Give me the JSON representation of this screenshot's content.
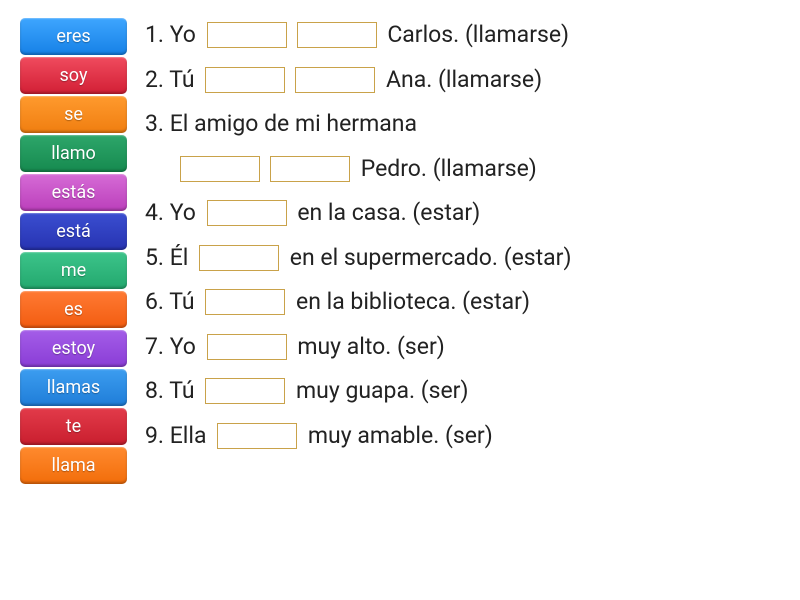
{
  "words": [
    {
      "label": "eres",
      "color1": "#3ea6ff",
      "color2": "#1681e6"
    },
    {
      "label": "soy",
      "color1": "#f04b5e",
      "color2": "#d21f35"
    },
    {
      "label": "se",
      "color1": "#ff9a2e",
      "color2": "#f07e10"
    },
    {
      "label": "llamo",
      "color1": "#2da66a",
      "color2": "#168a4f"
    },
    {
      "label": "estás",
      "color1": "#d66bd6",
      "color2": "#bb3fbb"
    },
    {
      "label": "está",
      "color1": "#3a4ed0",
      "color2": "#2733b2"
    },
    {
      "label": "me",
      "color1": "#3cc48a",
      "color2": "#23a86e"
    },
    {
      "label": "es",
      "color1": "#ff7a33",
      "color2": "#f25c10"
    },
    {
      "label": "estoy",
      "color1": "#a45de8",
      "color2": "#8a3dd6"
    },
    {
      "label": "llamas",
      "color1": "#3c9df0",
      "color2": "#1f7dd8"
    },
    {
      "label": "te",
      "color1": "#e23b4a",
      "color2": "#c91e2e"
    },
    {
      "label": "llama",
      "color1": "#ff8a2e",
      "color2": "#f26d0a"
    }
  ],
  "lines": {
    "l1a": "1. Yo ",
    "l1b": " Carlos. (llamarse)",
    "l2a": "2. Tú ",
    "l2b": " Ana. (llamarse)",
    "l3a": "3. El amigo de mi hermana",
    "l3b": " Pedro. (llamarse)",
    "l4a": "4. Yo ",
    "l4b": " en la casa. (estar)",
    "l5a": "5. Él ",
    "l5b": " en el supermercado. (estar)",
    "l6a": "6. Tú ",
    "l6b": " en la biblioteca. (estar)",
    "l7a": "7. Yo ",
    "l7b": " muy alto. (ser)",
    "l8a": "8. Tú ",
    "l8b": " muy guapa. (ser)",
    "l9a": "9. Ella ",
    "l9b": " muy amable. (ser)"
  }
}
